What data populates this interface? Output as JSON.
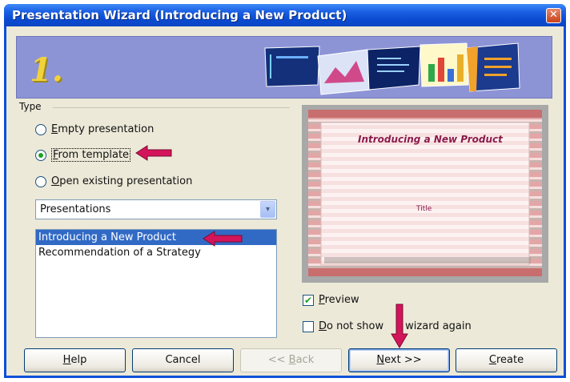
{
  "window": {
    "title": "Presentation Wizard (Introducing a New Product)",
    "close_glyph": "✕"
  },
  "banner": {
    "step": "1."
  },
  "type_section": {
    "label": "Type",
    "options": [
      {
        "accel": "E",
        "rest": "mpty presentation",
        "selected": false
      },
      {
        "accel": "F",
        "rest": "rom template",
        "selected": true
      },
      {
        "accel": "O",
        "rest": "pen existing presentation",
        "selected": false
      }
    ]
  },
  "category_dropdown": {
    "value": "Presentations",
    "arrow": "▾"
  },
  "template_list": {
    "items": [
      "Introducing a New Product",
      "Recommendation of a Strategy"
    ],
    "selected_index": 0
  },
  "preview": {
    "slide_title": "Introducing a New Product",
    "slide_subtitle": "Title"
  },
  "checkboxes": {
    "preview": {
      "accel": "P",
      "rest": "review",
      "checked": true,
      "check_glyph": "✔"
    },
    "do_not_show": {
      "accel": "D",
      "rest_a": "o not show ",
      "rest_b": "s wizard again",
      "checked": false
    }
  },
  "buttons": {
    "help": {
      "accel": "H",
      "rest": "elp"
    },
    "cancel": {
      "label": "Cancel"
    },
    "back": {
      "prefix": "<< ",
      "accel": "B",
      "rest": "ack"
    },
    "next": {
      "accel": "N",
      "rest": "ext >>"
    },
    "create": {
      "accel": "C",
      "rest": "reate"
    }
  },
  "colors": {
    "titlebar": "#0b4bd1",
    "banner": "#8d94d6",
    "selection": "#316ac5",
    "annotation_arrow": "#d4145a"
  },
  "icons": [
    "close-icon",
    "chevron-down-icon",
    "annotation-arrow-icon"
  ]
}
